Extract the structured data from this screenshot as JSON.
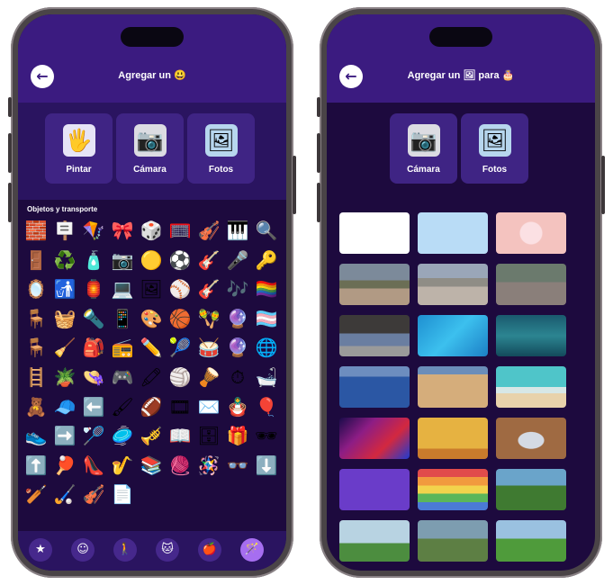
{
  "left_phone": {
    "header": {
      "back_icon": "←",
      "title": "Agregar un 😃"
    },
    "options": [
      {
        "label": "Pintar",
        "icon": "paint-hand-icon",
        "glyph": "🖐"
      },
      {
        "label": "Cámara",
        "icon": "camera-icon",
        "glyph": "📷"
      },
      {
        "label": "Fotos",
        "icon": "photos-icon",
        "glyph": "🖼"
      }
    ],
    "section_title": "Objetos y transporte",
    "emojis": [
      "🧱",
      "🪧",
      "🪁",
      "🎀",
      "🎲",
      "🥅",
      "🎻",
      "🎹",
      "🔍",
      "🚪",
      "♻️",
      "🧴",
      "📷",
      "🟡",
      "⚽",
      "🎸",
      "🎤",
      "🔑",
      "🪞",
      "🚮",
      "🏮",
      "💻",
      "🖼",
      "⚾",
      "🎸",
      "🎶",
      "🏳️‍🌈",
      "🪑",
      "🧺",
      "🔦",
      "📱",
      "🎨",
      "🏀",
      "🪇",
      "🔮",
      "🏳️‍⚧️",
      "🪑",
      "🧹",
      "🎒",
      "📻",
      "✏️",
      "🎾",
      "🥁",
      "🔮",
      "🌐",
      "🪜",
      "🪴",
      "👒",
      "🎮",
      "🖍",
      "🏐",
      "🪘",
      "⏱",
      "🛁",
      "🧸",
      "🧢",
      "⬅️",
      "🖌",
      "🏈",
      "🎞",
      "✉️",
      "🪆",
      "🎈",
      "👟",
      "➡️",
      "🏸",
      "🥏",
      "🎺",
      "📖",
      "🗄",
      "🎁",
      "🕶",
      "⬆️",
      "🏓",
      "👠",
      "🎷",
      "📚",
      "🧶",
      "🪅",
      "👓",
      "⬇️",
      "🏏",
      "🏑",
      "🎻",
      "📄"
    ],
    "tabs": [
      {
        "glyph": "★",
        "icon": "favorites-icon"
      },
      {
        "glyph": "☺",
        "icon": "smileys-icon"
      },
      {
        "glyph": "🚶",
        "icon": "people-activity-icon"
      },
      {
        "glyph": "🐱",
        "icon": "animals-icon"
      },
      {
        "glyph": "🍎",
        "icon": "food-icon"
      },
      {
        "glyph": "🪄",
        "icon": "objects-icon"
      }
    ],
    "active_tab_index": 5
  },
  "right_phone": {
    "header": {
      "back_icon": "←",
      "title": "Agregar un 🖼 para 🎂"
    },
    "options": [
      {
        "label": "Cámara",
        "icon": "camera-icon",
        "glyph": "📷"
      },
      {
        "label": "Fotos",
        "icon": "photos-icon",
        "glyph": "🖼"
      }
    ],
    "backgrounds": [
      {
        "name": "white",
        "css": "#ffffff"
      },
      {
        "name": "light-blue",
        "css": "#b9dcf6"
      },
      {
        "name": "pink-heart",
        "css": "radial-gradient(circle at 50% 50%, #fbe0e3 0 12px, #f4c3bf 13px)"
      },
      {
        "name": "street",
        "css": "linear-gradient(#7c8a9a 0 40%, #6b6e55 40% 60%, #b19a84 60%)"
      },
      {
        "name": "plaza",
        "css": "linear-gradient(#9aa6b8 0 35%, #8f8d86 35% 55%, #bdb3a9 55%)"
      },
      {
        "name": "alley",
        "css": "linear-gradient(#6b7a6d 0 45%, #8a7f7a 45%)"
      },
      {
        "name": "storefront",
        "css": "linear-gradient(#3d3a39 0 45%, #6a7ea1 45% 75%, #9a9a9a 75%)"
      },
      {
        "name": "pool",
        "css": "linear-gradient(135deg, #1e8fd1, #3cc0ee, #1c7fc6)"
      },
      {
        "name": "underwater",
        "css": "linear-gradient(#1a5a6e, #2c8591, #134a5b)"
      },
      {
        "name": "sea",
        "css": "linear-gradient(#6d8dbf 0 25%, #2b57a4 25%)"
      },
      {
        "name": "sand",
        "css": "linear-gradient(#6b8db9 0 20%, #d5ad7b 20%)"
      },
      {
        "name": "beach",
        "css": "linear-gradient(#4fc5c9 0 50%, #d7e7e6 50% 65%, #e8d2ab 65%)"
      },
      {
        "name": "stage",
        "css": "linear-gradient(135deg, #1a0b4a, #8d1d85, #d3283f, #1f3bd0)"
      },
      {
        "name": "yellow-room",
        "css": "linear-gradient(#e6b241 0 75%, #c97b2c 75%)"
      },
      {
        "name": "table-plate",
        "css": "radial-gradient(ellipse at 50% 55%, #d4dae4 0 14px, #9f6a42 15px)"
      },
      {
        "name": "purple",
        "css": "#6a3cc9"
      },
      {
        "name": "rainbow",
        "css": "linear-gradient(#e14b4b 0 20%, #f19a3e 20% 40%, #f2d34c 40% 60%, #5bb65a 60% 80%, #4b7ad6 80%)"
      },
      {
        "name": "flower-field",
        "css": "linear-gradient(#6aa4ca 0 40%, #3f7a31 40%)"
      },
      {
        "name": "park-1",
        "css": "linear-gradient(#b8d3e2 0 55%, #4c8d3f 55%)"
      },
      {
        "name": "park-2",
        "css": "linear-gradient(#7d9db0 0 45%, #5d7f44 45%)"
      },
      {
        "name": "park-3",
        "css": "linear-gradient(#9ac1e0 0 45%, #4f9b3b 45%)"
      }
    ]
  },
  "colors": {
    "header": "#3b1b80",
    "screen_bg": "#1d0a3e",
    "tile": "#3f2484",
    "active_tab": "#a66ef0"
  }
}
